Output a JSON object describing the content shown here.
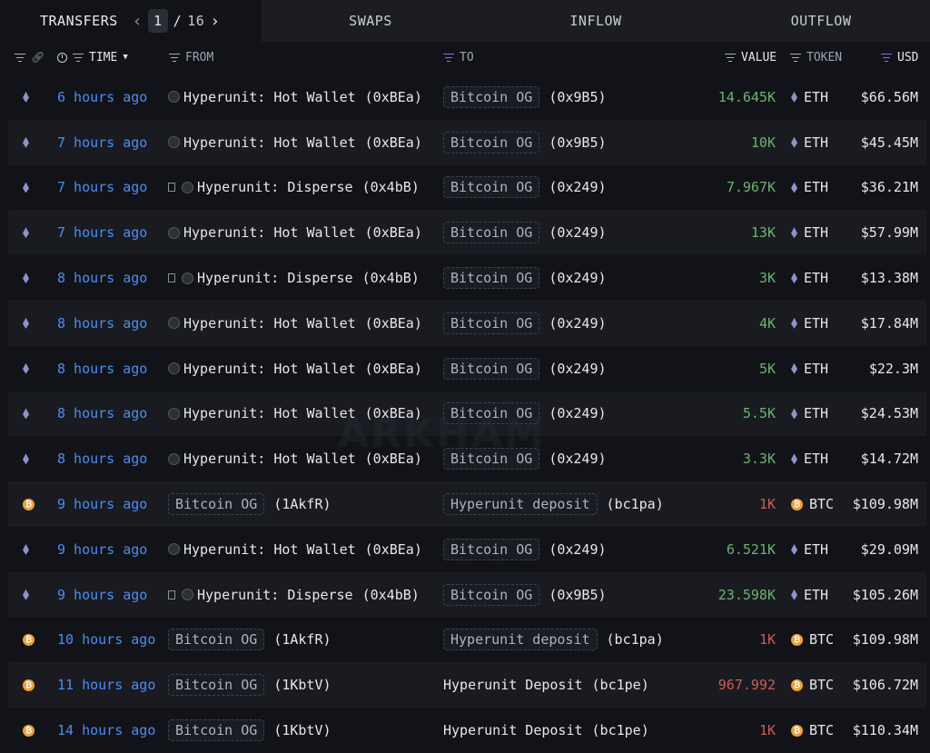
{
  "tabs": {
    "transfers": "TRANSFERS",
    "swaps": "SWAPS",
    "inflow": "INFLOW",
    "outflow": "OUTFLOW",
    "page_current": "1",
    "page_sep": "/",
    "page_total": "16"
  },
  "columns": {
    "time": "TIME",
    "from": "FROM",
    "to": "TO",
    "value": "VALUE",
    "token": "TOKEN",
    "usd": "USD"
  },
  "watermark": "ARKHAM",
  "colors": {
    "accent_blue": "#4a8df2",
    "value_green": "#67b56f",
    "value_red": "#d25a54",
    "btc_orange": "#f0a233",
    "filter_purple": "#8a6cf0"
  },
  "rows": [
    {
      "chain": "eth",
      "time": "6 hours ago",
      "from_doc": false,
      "from_tag": false,
      "from_name": "Hyperunit: Hot Wallet",
      "from_addr": "(0xBEa)",
      "to_tag": true,
      "to_name": "Bitcoin OG",
      "to_addr": "(0x9B5)",
      "value": "14.645K",
      "value_color": "green",
      "token": "ETH",
      "usd": "$66.56M"
    },
    {
      "chain": "eth",
      "time": "7 hours ago",
      "from_doc": false,
      "from_tag": false,
      "from_name": "Hyperunit: Hot Wallet",
      "from_addr": "(0xBEa)",
      "to_tag": true,
      "to_name": "Bitcoin OG",
      "to_addr": "(0x9B5)",
      "value": "10K",
      "value_color": "green",
      "token": "ETH",
      "usd": "$45.45M"
    },
    {
      "chain": "eth",
      "time": "7 hours ago",
      "from_doc": true,
      "from_tag": false,
      "from_name": "Hyperunit: Disperse",
      "from_addr": "(0x4bB)",
      "to_tag": true,
      "to_name": "Bitcoin OG",
      "to_addr": "(0x249)",
      "value": "7.967K",
      "value_color": "green",
      "token": "ETH",
      "usd": "$36.21M"
    },
    {
      "chain": "eth",
      "time": "7 hours ago",
      "from_doc": false,
      "from_tag": false,
      "from_name": "Hyperunit: Hot Wallet",
      "from_addr": "(0xBEa)",
      "to_tag": true,
      "to_name": "Bitcoin OG",
      "to_addr": "(0x249)",
      "value": "13K",
      "value_color": "green",
      "token": "ETH",
      "usd": "$57.99M"
    },
    {
      "chain": "eth",
      "time": "8 hours ago",
      "from_doc": true,
      "from_tag": false,
      "from_name": "Hyperunit: Disperse",
      "from_addr": "(0x4bB)",
      "to_tag": true,
      "to_name": "Bitcoin OG",
      "to_addr": "(0x249)",
      "value": "3K",
      "value_color": "green",
      "token": "ETH",
      "usd": "$13.38M"
    },
    {
      "chain": "eth",
      "time": "8 hours ago",
      "from_doc": false,
      "from_tag": false,
      "from_name": "Hyperunit: Hot Wallet",
      "from_addr": "(0xBEa)",
      "to_tag": true,
      "to_name": "Bitcoin OG",
      "to_addr": "(0x249)",
      "value": "4K",
      "value_color": "green",
      "token": "ETH",
      "usd": "$17.84M"
    },
    {
      "chain": "eth",
      "time": "8 hours ago",
      "from_doc": false,
      "from_tag": false,
      "from_name": "Hyperunit: Hot Wallet",
      "from_addr": "(0xBEa)",
      "to_tag": true,
      "to_name": "Bitcoin OG",
      "to_addr": "(0x249)",
      "value": "5K",
      "value_color": "green",
      "token": "ETH",
      "usd": "$22.3M"
    },
    {
      "chain": "eth",
      "time": "8 hours ago",
      "from_doc": false,
      "from_tag": false,
      "from_name": "Hyperunit: Hot Wallet",
      "from_addr": "(0xBEa)",
      "to_tag": true,
      "to_name": "Bitcoin OG",
      "to_addr": "(0x249)",
      "value": "5.5K",
      "value_color": "green",
      "token": "ETH",
      "usd": "$24.53M"
    },
    {
      "chain": "eth",
      "time": "8 hours ago",
      "from_doc": false,
      "from_tag": false,
      "from_name": "Hyperunit: Hot Wallet",
      "from_addr": "(0xBEa)",
      "to_tag": true,
      "to_name": "Bitcoin OG",
      "to_addr": "(0x249)",
      "value": "3.3K",
      "value_color": "green",
      "token": "ETH",
      "usd": "$14.72M"
    },
    {
      "chain": "btc",
      "time": "9 hours ago",
      "from_doc": false,
      "from_tag": true,
      "from_name": "Bitcoin OG",
      "from_addr": "(1AkfR)",
      "to_tag": true,
      "to_name": "Hyperunit deposit",
      "to_addr": "(bc1pa)",
      "value": "1K",
      "value_color": "red",
      "token": "BTC",
      "usd": "$109.98M"
    },
    {
      "chain": "eth",
      "time": "9 hours ago",
      "from_doc": false,
      "from_tag": false,
      "from_name": "Hyperunit: Hot Wallet",
      "from_addr": "(0xBEa)",
      "to_tag": true,
      "to_name": "Bitcoin OG",
      "to_addr": "(0x249)",
      "value": "6.521K",
      "value_color": "green",
      "token": "ETH",
      "usd": "$29.09M"
    },
    {
      "chain": "eth",
      "time": "9 hours ago",
      "from_doc": true,
      "from_tag": false,
      "from_name": "Hyperunit: Disperse",
      "from_addr": "(0x4bB)",
      "to_tag": true,
      "to_name": "Bitcoin OG",
      "to_addr": "(0x9B5)",
      "value": "23.598K",
      "value_color": "green",
      "token": "ETH",
      "usd": "$105.26M"
    },
    {
      "chain": "btc",
      "time": "10 hours ago",
      "from_doc": false,
      "from_tag": true,
      "from_name": "Bitcoin OG",
      "from_addr": "(1AkfR)",
      "to_tag": true,
      "to_name": "Hyperunit deposit",
      "to_addr": "(bc1pa)",
      "value": "1K",
      "value_color": "red",
      "token": "BTC",
      "usd": "$109.98M"
    },
    {
      "chain": "btc",
      "time": "11 hours ago",
      "from_doc": false,
      "from_tag": true,
      "from_name": "Bitcoin OG",
      "from_addr": "(1KbtV)",
      "to_tag": false,
      "to_name": "Hyperunit Deposit",
      "to_addr": "(bc1pe)",
      "value": "967.992",
      "value_color": "red",
      "token": "BTC",
      "usd": "$106.72M"
    },
    {
      "chain": "btc",
      "time": "14 hours ago",
      "from_doc": false,
      "from_tag": true,
      "from_name": "Bitcoin OG",
      "from_addr": "(1KbtV)",
      "to_tag": false,
      "to_name": "Hyperunit Deposit",
      "to_addr": "(bc1pe)",
      "value": "1K",
      "value_color": "red",
      "token": "BTC",
      "usd": "$110.34M"
    }
  ]
}
